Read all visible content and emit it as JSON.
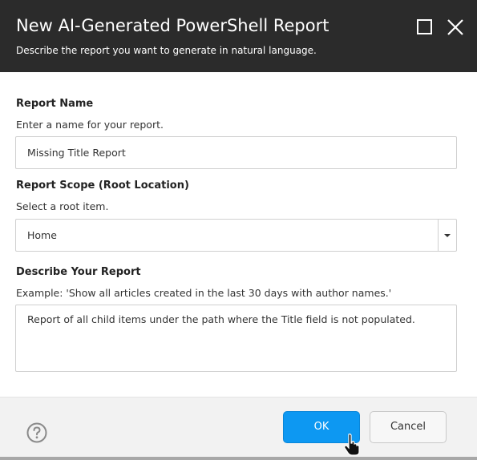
{
  "dialog": {
    "title": "New AI-Generated PowerShell Report",
    "subtitle": "Describe the report you want to generate in natural language.",
    "maximize_icon": "maximize-icon",
    "close_icon": "close-icon"
  },
  "report_name": {
    "label": "Report Name",
    "hint": "Enter a name for your report.",
    "value": "Missing Title Report"
  },
  "report_scope": {
    "label": "Report Scope (Root Location)",
    "hint": "Select a root item.",
    "selected": "Home"
  },
  "description": {
    "label": "Describe Your Report",
    "hint": "Example: 'Show all articles created in the last 30 days with author names.'",
    "value": "Report of all child items under the path where the Title field is not populated."
  },
  "footer": {
    "help_icon": "help-icon",
    "ok_label": "OK",
    "cancel_label": "Cancel"
  },
  "colors": {
    "header_bg": "#2b2b2b",
    "primary_button": "#0d98f2",
    "footer_bg": "#f2f2f2"
  }
}
